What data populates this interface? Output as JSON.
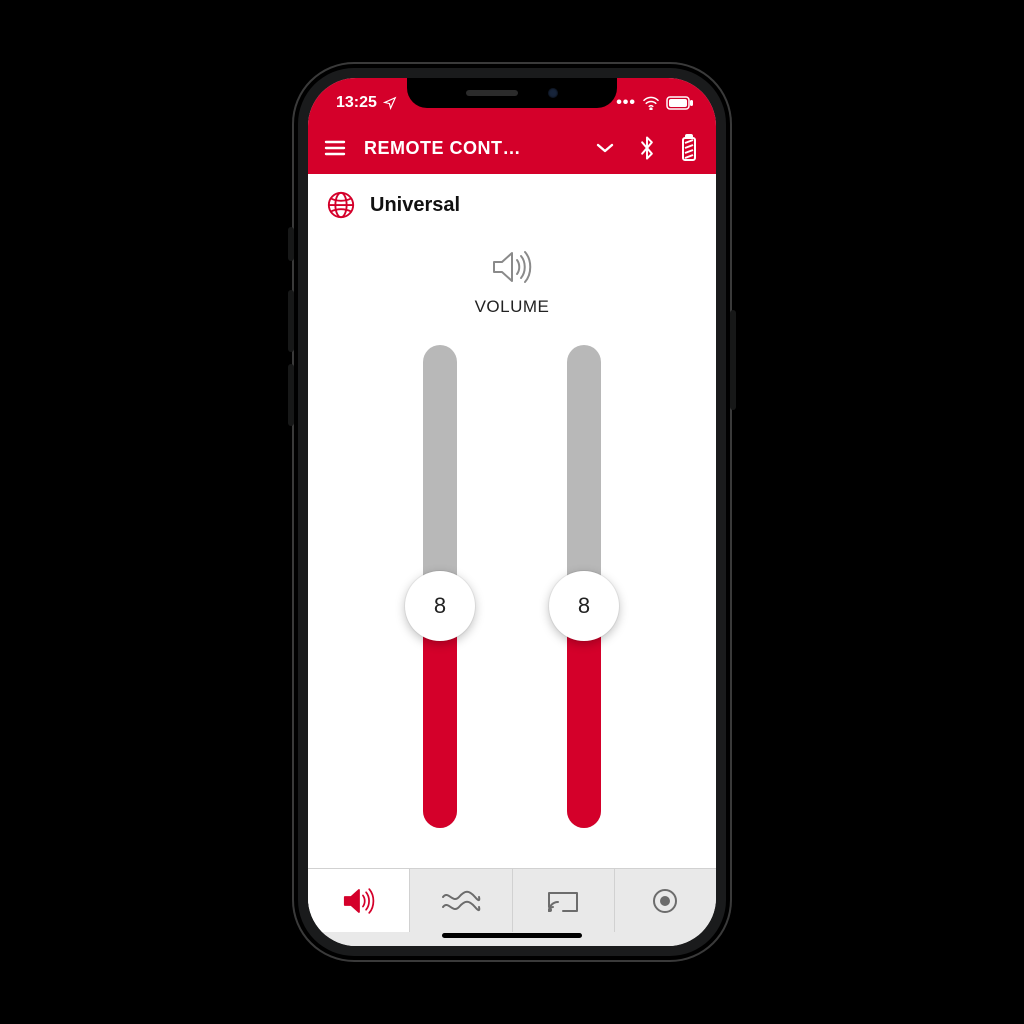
{
  "colors": {
    "brand": "#d4002a"
  },
  "statusbar": {
    "time": "13:25"
  },
  "header": {
    "title": "REMOTE CONT…"
  },
  "program": {
    "name": "Universal"
  },
  "volume": {
    "label": "VOLUME",
    "left": {
      "value": "8"
    },
    "right": {
      "value": "8"
    }
  },
  "tabs": {
    "volume_icon": "volume-icon",
    "equalizer_icon": "wave-icon",
    "streaming_icon": "cast-icon",
    "tinnitus_icon": "target-icon"
  }
}
